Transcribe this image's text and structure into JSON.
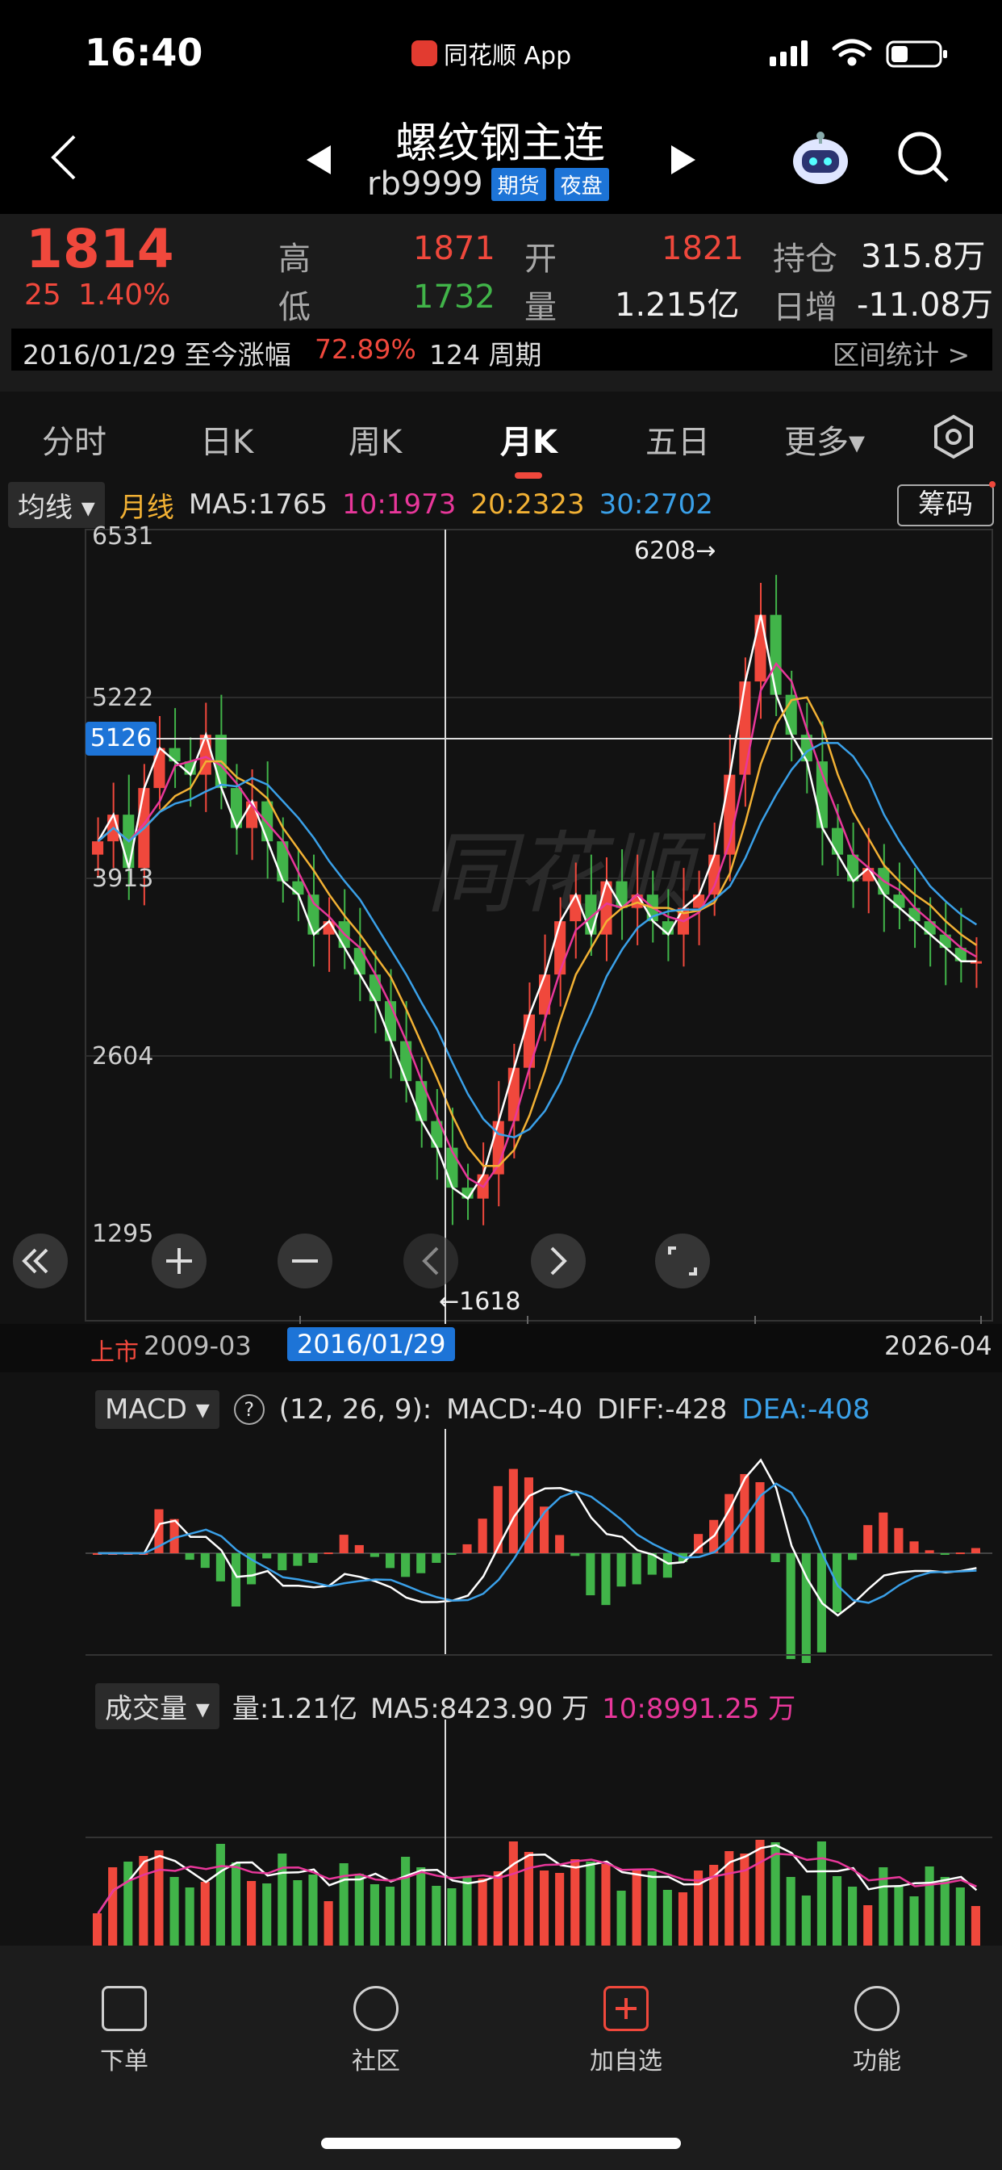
{
  "status": {
    "time": "16:40",
    "app_badge": "同花顺 App"
  },
  "header": {
    "title": "螺纹钢主连",
    "code": "rb9999",
    "tag1": "期货",
    "tag2": "夜盘"
  },
  "quote": {
    "price": "1814",
    "change": "25",
    "change_pct": "1.40%",
    "high_label": "高",
    "high": "1871",
    "low_label": "低",
    "low": "1732",
    "open_label": "开",
    "open": "1821",
    "vol_label": "量",
    "volume": "1.215亿",
    "oi_label": "持仓",
    "oi": "315.8万",
    "oi_chg_label": "日增",
    "oi_chg": "-11.08万",
    "range_date": "2016/01/29 至今涨幅",
    "range_pct": "72.89%",
    "range_periods": "124 周期",
    "range_stat": "区间统计 >"
  },
  "tabs": [
    "分时",
    "日K",
    "周K",
    "月K",
    "五日",
    "更多▾"
  ],
  "active_tab": "月K",
  "ma": {
    "selector": "均线",
    "period": "月线",
    "ma5": "MA5:1765",
    "ma10": "10:1973",
    "ma20": "20:2323",
    "ma30": "30:2702",
    "chip_button": "筹码"
  },
  "colors": {
    "up": "#f0483c",
    "down": "#41b449",
    "ma5": "#ffffff",
    "ma10": "#e8379a",
    "ma20": "#f2b134",
    "ma30": "#3aa0e8",
    "accent": "#1d74d7"
  },
  "kline": {
    "axis_labels": [
      "6531",
      "5222",
      "3913",
      "2604",
      "1295"
    ],
    "crosshair_value": "5126",
    "max_label": "6208→",
    "min_label": "←1618",
    "watermark": "同花顺",
    "date_start_label": "上市",
    "date_start": "2009-03",
    "date_cursor": "2016/01/29",
    "date_end": "2026-04"
  },
  "macd": {
    "selector": "MACD",
    "params": "(12, 26, 9):",
    "macd": "MACD:-40",
    "diff": "DIFF:-428",
    "dea": "DEA:-408"
  },
  "volume_panel": {
    "selector": "成交量",
    "vol": "量:1.21亿",
    "ma5": "MA5:8423.90 万",
    "ma10": "10:8991.25 万"
  },
  "nav": [
    "下单",
    "社区",
    "加自选",
    "功能"
  ]
}
